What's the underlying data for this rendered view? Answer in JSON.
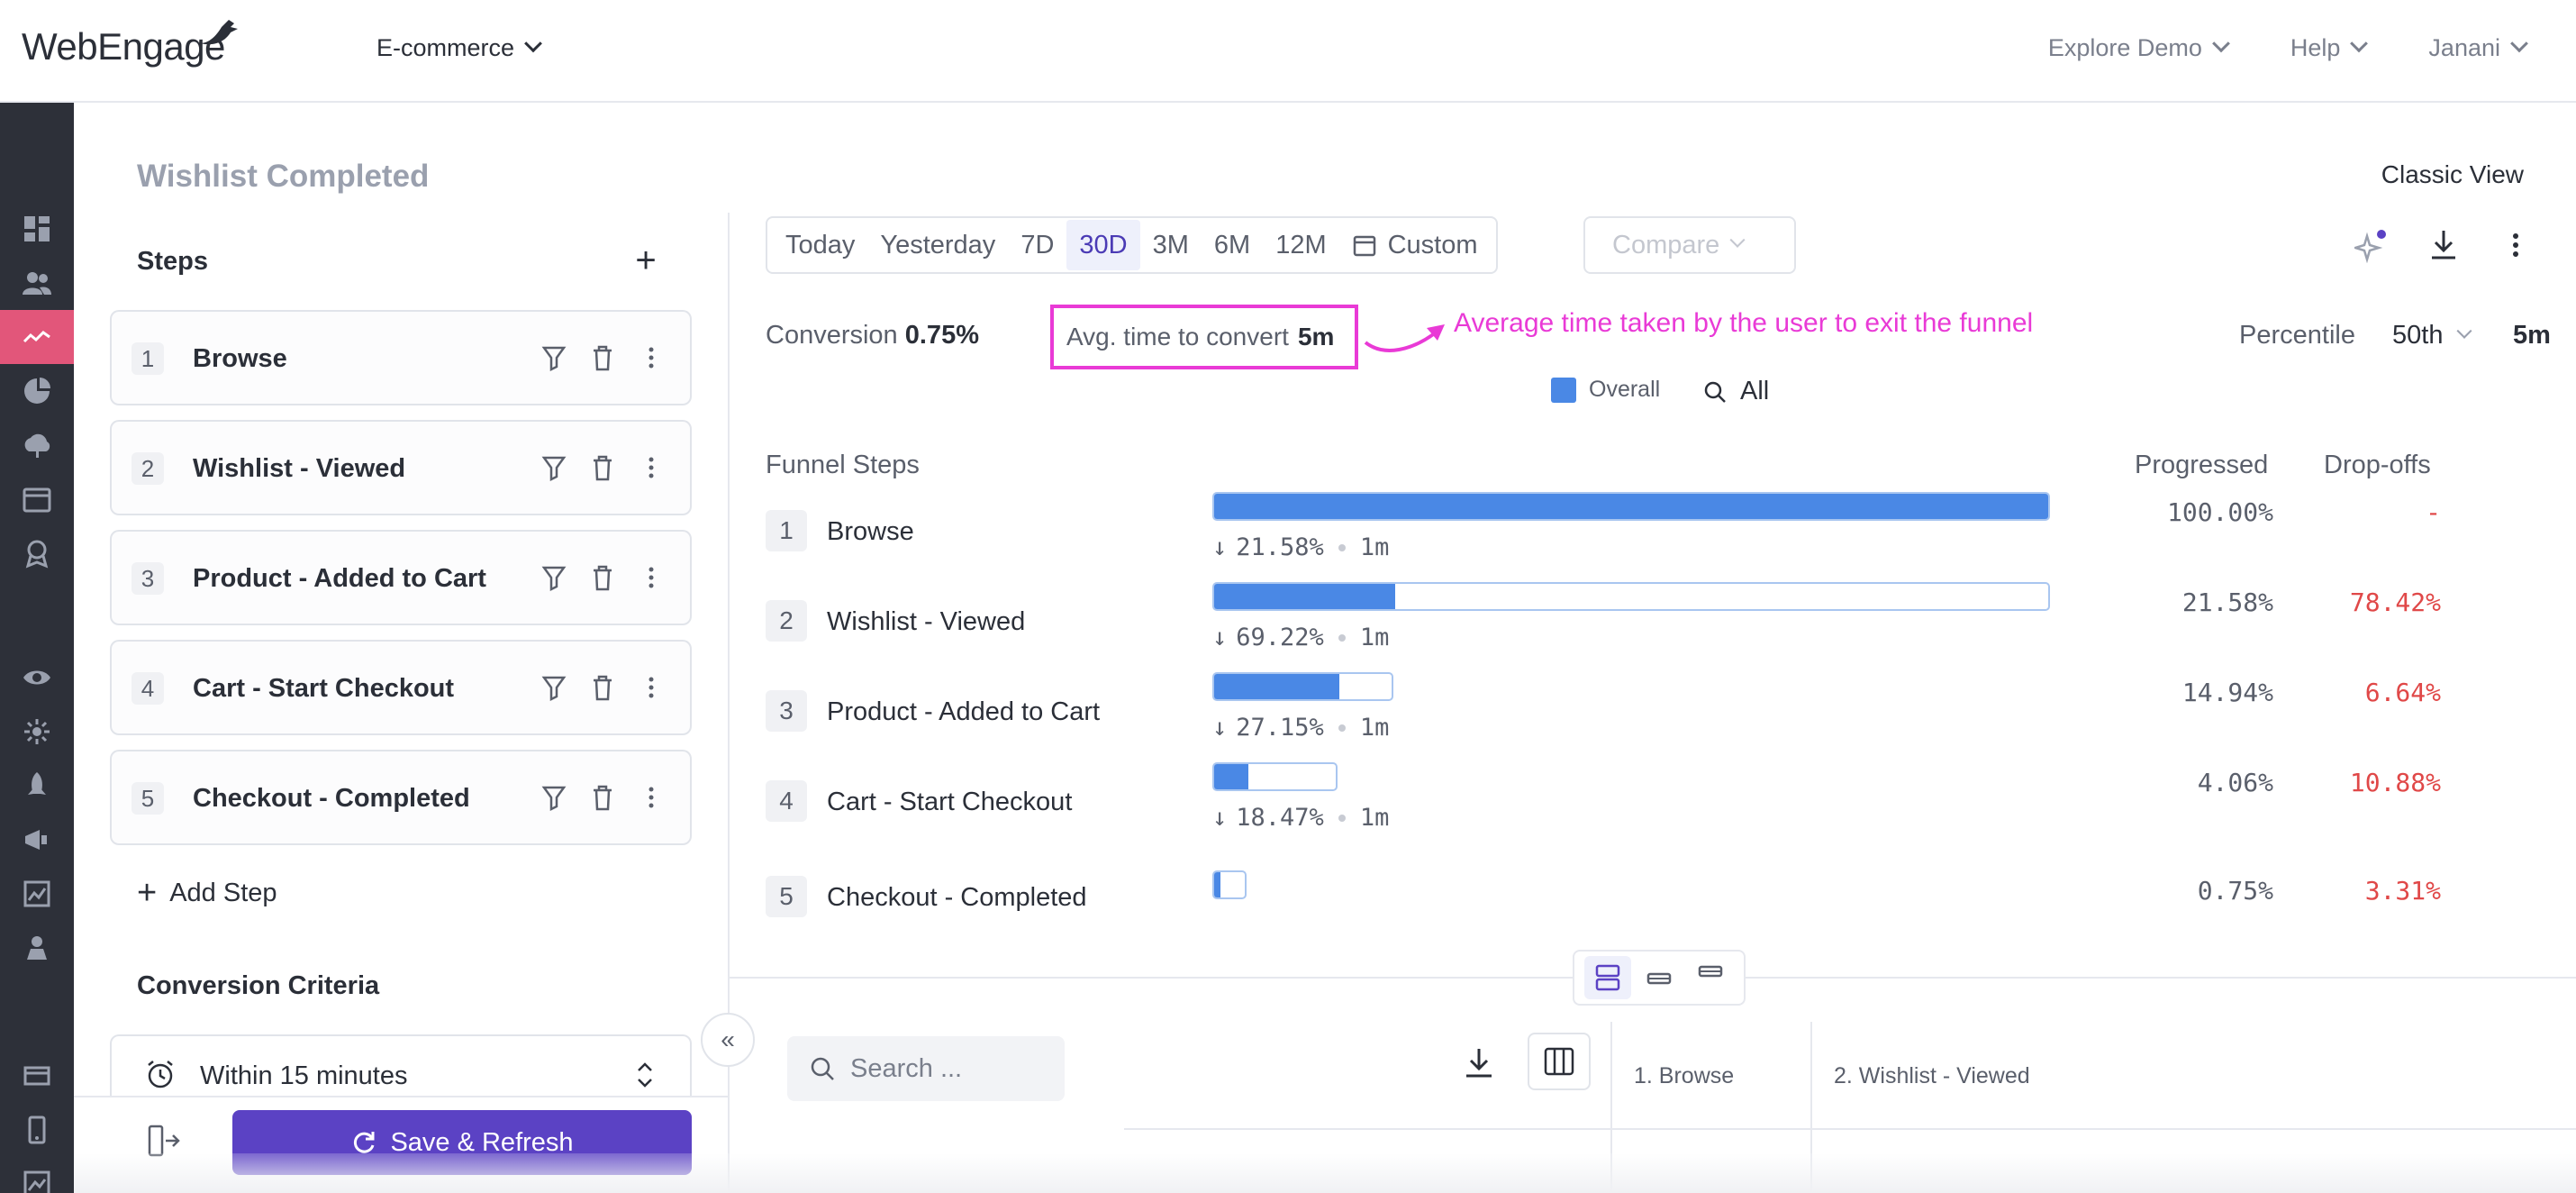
{
  "app": {
    "logo_text": "WebEngage",
    "project": "E-commerce",
    "top_menu": [
      "Explore Demo",
      "Help",
      "Janani"
    ]
  },
  "page": {
    "title": "Wishlist Completed",
    "classic_view": "Classic View"
  },
  "steps_panel": {
    "title": "Steps",
    "steps": [
      {
        "num": "1",
        "name": "Browse"
      },
      {
        "num": "2",
        "name": "Wishlist - Viewed"
      },
      {
        "num": "3",
        "name": "Product - Added to Cart"
      },
      {
        "num": "4",
        "name": "Cart - Start Checkout"
      },
      {
        "num": "5",
        "name": "Checkout - Completed"
      }
    ],
    "add_step": "Add Step",
    "conversion_criteria": "Conversion Criteria",
    "within": "Within 15 minutes",
    "save_refresh": "Save & Refresh"
  },
  "date_range": {
    "tabs": [
      "Today",
      "Yesterday",
      "7D",
      "30D",
      "3M",
      "6M",
      "12M"
    ],
    "active": "30D",
    "custom": "Custom",
    "compare": "Compare"
  },
  "summary": {
    "conversion_label": "Conversion",
    "conversion_value": "0.75%",
    "avg_label": "Avg. time to convert",
    "avg_value": "5m",
    "annotation": "Average time taken by the user to exit the funnel",
    "percentile_label": "Percentile",
    "percentile_select": "50th",
    "percentile_value": "5m"
  },
  "legend": {
    "overall": "Overall",
    "all": "All",
    "overall_color": "#4a88e5"
  },
  "funnel": {
    "headers": {
      "steps": "Funnel Steps",
      "progressed": "Progressed",
      "dropoffs": "Drop-offs"
    },
    "rows": [
      {
        "num": "1",
        "name": "Browse",
        "pct": 1.0,
        "sub_pct": "21.58%",
        "sub_time": "1m",
        "progressed": "100.00%",
        "dropoff": "-"
      },
      {
        "num": "2",
        "name": "Wishlist - Viewed",
        "pct": 0.2158,
        "sub_pct": "69.22%",
        "sub_time": "1m",
        "progressed": "21.58%",
        "dropoff": "78.42%"
      },
      {
        "num": "3",
        "name": "Product - Added to Cart",
        "pct": 0.1494,
        "sub_pct": "27.15%",
        "sub_time": "1m",
        "progressed": "14.94%",
        "dropoff": "6.64%"
      },
      {
        "num": "4",
        "name": "Cart - Start Checkout",
        "pct": 0.0406,
        "sub_pct": "18.47%",
        "sub_time": "1m",
        "progressed": "4.06%",
        "dropoff": "10.88%"
      },
      {
        "num": "5",
        "name": "Checkout - Completed",
        "pct": 0.0075,
        "sub_pct": "",
        "sub_time": "",
        "progressed": "0.75%",
        "dropoff": "3.31%"
      }
    ]
  },
  "table": {
    "search_placeholder": "Search ...",
    "columns": [
      "1. Browse",
      "2. Wishlist - Viewed"
    ]
  }
}
